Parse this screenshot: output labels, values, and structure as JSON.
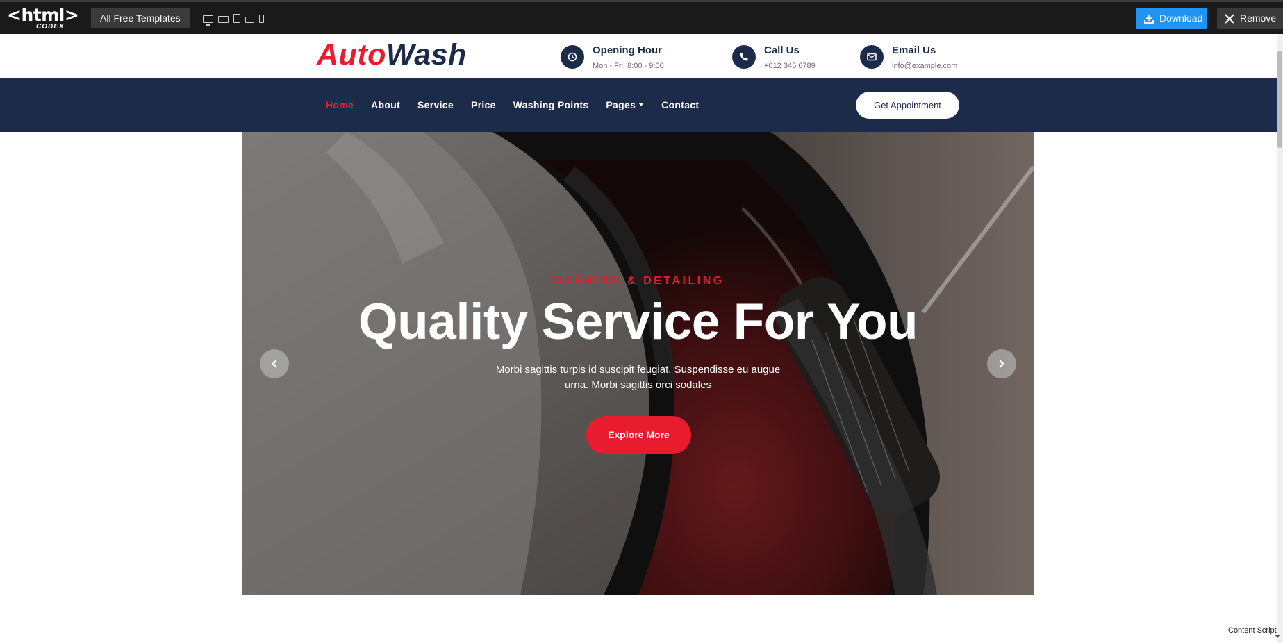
{
  "preview_bar": {
    "logo_text": "<html>",
    "logo_sub": "CODEX",
    "templates_label": "All Free Templates",
    "devices": [
      "desktop-icon",
      "laptop-icon",
      "tablet-icon",
      "tablet-landscape-icon",
      "phone-icon"
    ],
    "download_label": "Download",
    "remove_label": "Remove"
  },
  "header": {
    "brand_part1": "Auto",
    "brand_part2": "Wash",
    "contacts": [
      {
        "title": "Opening Hour",
        "detail": "Mon - Fri, 8:00 - 9:00",
        "icon": "clock-icon"
      },
      {
        "title": "Call Us",
        "detail": "+012 345 6789",
        "icon": "phone-icon"
      },
      {
        "title": "Email Us",
        "detail": "info@example.com",
        "icon": "envelope-icon"
      }
    ]
  },
  "nav": {
    "items": [
      "Home",
      "About",
      "Service",
      "Price",
      "Washing Points",
      "Pages",
      "Contact"
    ],
    "active": "Home",
    "appointment_label": "Get Appointment"
  },
  "hero": {
    "subtitle": "WASHING & DETAILING",
    "title": "Quality Service For You",
    "text": "Morbi sagittis turpis id suscipit feugiat. Suspendisse eu augue urna. Morbi sagittis orci sodales",
    "button_label": "Explore More"
  },
  "footer_note": "Content Script",
  "colors": {
    "brand_red": "#e81c2e",
    "navy": "#1d2b4b",
    "download_blue": "#2094f3",
    "topbar": "#1a1a1a"
  }
}
